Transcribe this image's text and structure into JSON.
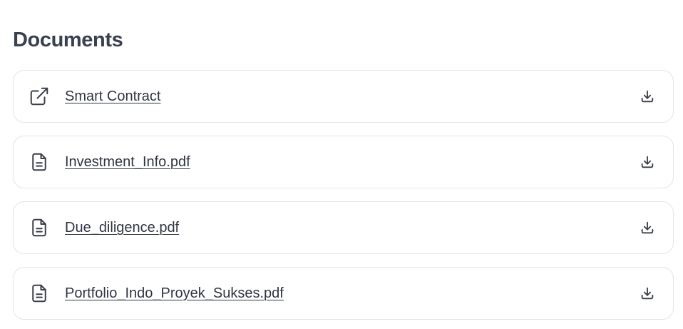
{
  "section": {
    "title": "Documents"
  },
  "documents": [
    {
      "label": "Smart Contract",
      "icon": "external-link-icon",
      "action_icon": "download-icon"
    },
    {
      "label": "Investment_Info.pdf",
      "icon": "file-text-icon",
      "action_icon": "download-icon"
    },
    {
      "label": "Due_diligence.pdf",
      "icon": "file-text-icon",
      "action_icon": "download-icon"
    },
    {
      "label": "Portfolio_Indo_Proyek_Sukses.pdf",
      "icon": "file-text-icon",
      "action_icon": "download-icon"
    }
  ],
  "colors": {
    "title": "#394150",
    "text": "#2f3542",
    "icon": "#3a3f4a",
    "border": "#e3e4e7",
    "background": "#ffffff"
  }
}
